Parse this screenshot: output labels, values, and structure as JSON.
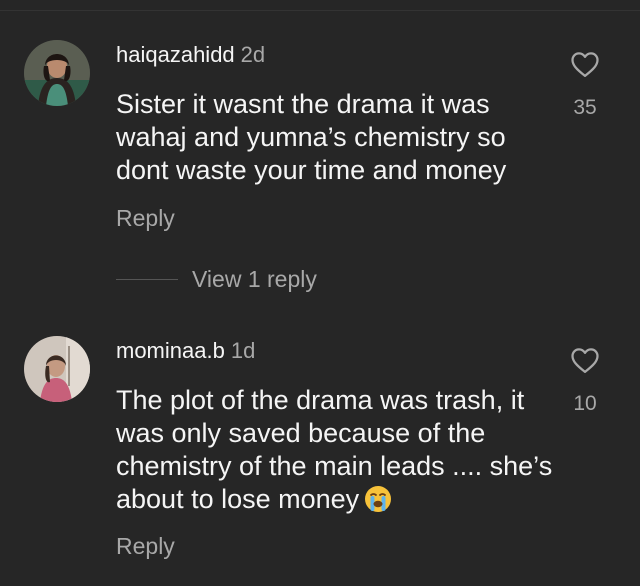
{
  "comments": [
    {
      "username": "haiqazahidd",
      "age": "2d",
      "text": "Sister it wasnt the drama it was wahaj and yumna’s chemistry so dont waste your time and money",
      "likes": "35",
      "reply_label": "Reply",
      "view_replies_label": "View 1 reply"
    },
    {
      "username": "mominaa.b",
      "age": "1d",
      "text": "The plot of the drama was trash, it was only saved because of the chemistry of the main leads .... she’s about to lose money",
      "emoji": "loudly-crying-face",
      "likes": "10",
      "reply_label": "Reply"
    }
  ],
  "colors": {
    "background": "#262626",
    "primary_text": "#f5f5f5",
    "secondary_text": "#a8a8a8"
  },
  "icons": [
    "heart-outline-icon",
    "loudly-crying-face-emoji"
  ]
}
